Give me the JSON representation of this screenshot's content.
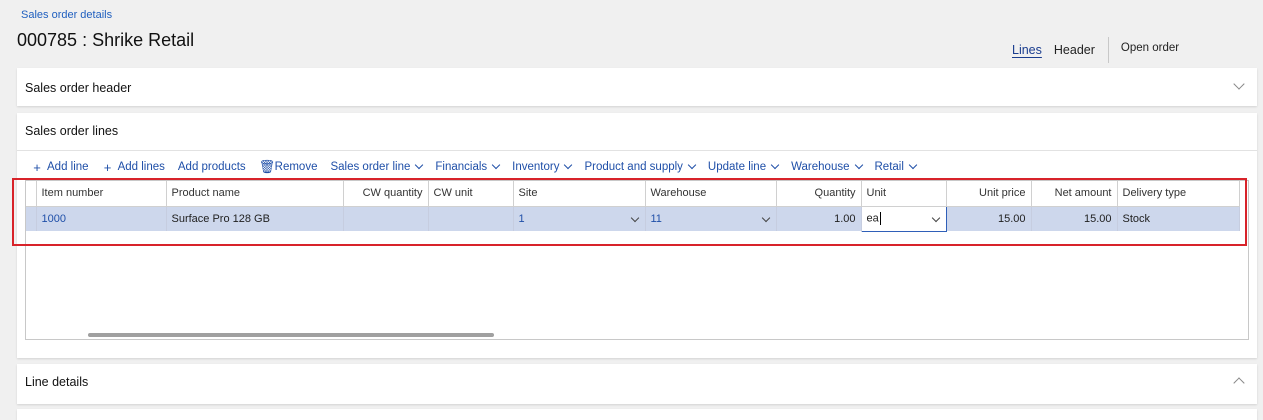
{
  "breadcrumb": "Sales order details",
  "title": "000785 : Shrike Retail",
  "top_tabs": {
    "lines": "Lines",
    "header": "Header",
    "open_order": "Open order"
  },
  "sections": {
    "header": "Sales order header",
    "lines": "Sales order lines",
    "details": "Line details"
  },
  "toolbar": {
    "add_line": "Add line",
    "add_lines": "Add lines",
    "add_products": "Add products",
    "remove": "Remove",
    "sales_order_line": "Sales order line",
    "financials": "Financials",
    "inventory": "Inventory",
    "product_and_supply": "Product and supply",
    "update_line": "Update line",
    "warehouse": "Warehouse",
    "retail": "Retail"
  },
  "columns": {
    "item_number": "Item number",
    "product_name": "Product name",
    "cw_quantity": "CW quantity",
    "cw_unit": "CW unit",
    "site": "Site",
    "warehouse": "Warehouse",
    "quantity": "Quantity",
    "unit": "Unit",
    "unit_price": "Unit price",
    "net_amount": "Net amount",
    "delivery_type": "Delivery type"
  },
  "rows": [
    {
      "item_number": "1000",
      "product_name": "Surface Pro 128 GB",
      "cw_quantity": "",
      "cw_unit": "",
      "site": "1",
      "warehouse": "11",
      "quantity": "1.00",
      "unit": "ea",
      "unit_price": "15.00",
      "net_amount": "15.00",
      "delivery_type": "Stock"
    }
  ],
  "colors": {
    "accent": "#1f4fa8",
    "selected_row": "#cdd7ec",
    "highlight": "#d8232a"
  }
}
